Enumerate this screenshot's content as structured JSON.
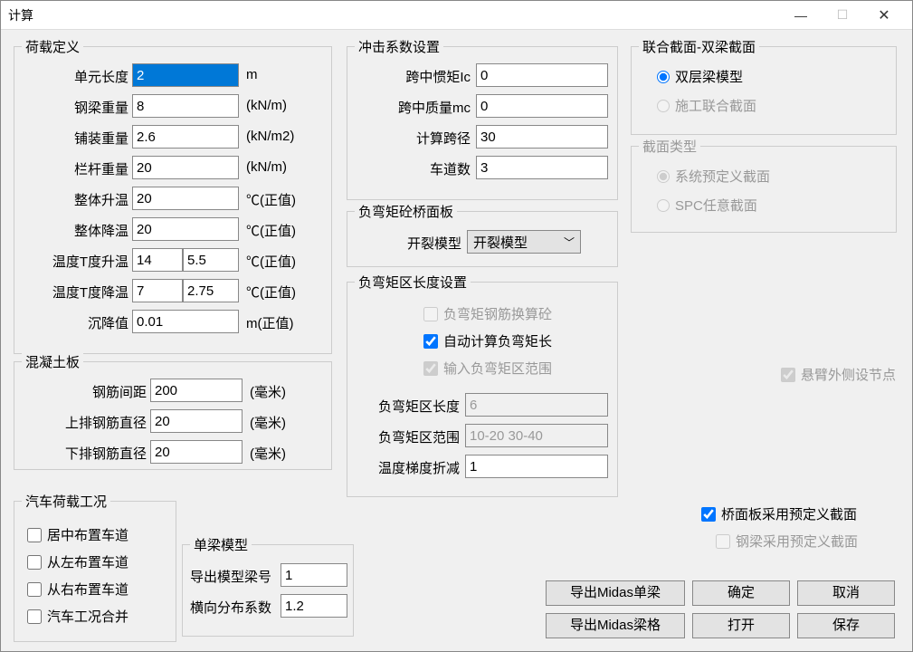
{
  "window": {
    "title": "计算"
  },
  "load": {
    "legend": "荷载定义",
    "unitLength": {
      "label": "单元长度",
      "value": "2",
      "unit": "m"
    },
    "steelBeamWeight": {
      "label": "钢梁重量",
      "value": "8",
      "unit": "(kN/m)"
    },
    "pavingWeight": {
      "label": "铺装重量",
      "value": "2.6",
      "unit": "(kN/m2)"
    },
    "railWeight": {
      "label": "栏杆重量",
      "value": "20",
      "unit": "(kN/m)"
    },
    "tempUp": {
      "label": "整体升温",
      "value": "20",
      "unit": "℃(正值)"
    },
    "tempDown": {
      "label": "整体降温",
      "value": "20",
      "unit": "℃(正值)"
    },
    "tGradUp": {
      "label": "温度T度升温",
      "v1": "14",
      "v2": "5.5",
      "unit": "℃(正值)"
    },
    "tGradDown": {
      "label": "温度T度降温",
      "v1": "7",
      "v2": "2.75",
      "unit": "℃(正值)"
    },
    "settlement": {
      "label": "沉降值",
      "value": "0.01",
      "unit": "m(正值)"
    }
  },
  "concrete": {
    "legend": "混凝土板",
    "rebarSpacing": {
      "label": "钢筋间距",
      "value": "200",
      "unit": "(毫米)"
    },
    "topRebarDia": {
      "label": "上排钢筋直径",
      "value": "20",
      "unit": "(毫米)"
    },
    "botRebarDia": {
      "label": "下排钢筋直径",
      "value": "20",
      "unit": "(毫米)"
    }
  },
  "vehicle": {
    "legend": "汽车荷载工况",
    "center": "居中布置车道",
    "left": "从左布置车道",
    "right": "从右布置车道",
    "combine": "汽车工况合并"
  },
  "singleBeam": {
    "legend": "单梁模型",
    "exportBeamNo": {
      "label": "导出模型梁号",
      "value": "1"
    },
    "lateralCoef": {
      "label": "横向分布系数",
      "value": "1.2"
    }
  },
  "impact": {
    "legend": "冲击系数设置",
    "midInertia": {
      "label": "跨中惯矩Ic",
      "value": "0"
    },
    "midMass": {
      "label": "跨中质量mc",
      "value": "0"
    },
    "span": {
      "label": "计算跨径",
      "value": "30"
    },
    "lanes": {
      "label": "车道数",
      "value": "3"
    }
  },
  "negDeck": {
    "legend": "负弯矩砼桥面板",
    "crackModelLabel": "开裂模型",
    "crackModelValue": "开裂模型"
  },
  "negZone": {
    "legend": "负弯矩区长度设置",
    "cbConvert": "负弯矩钢筋换算砼",
    "cbAuto": "自动计算负弯矩长",
    "cbRange": "输入负弯矩区范围",
    "negLength": {
      "label": "负弯矩区长度",
      "value": "6"
    },
    "negRange": {
      "label": "负弯矩区范围",
      "value": "10-20 30-40"
    },
    "tempGradRed": {
      "label": "温度梯度折减",
      "value": "1"
    }
  },
  "composite": {
    "legend": "联合截面-双梁截面",
    "doubleLayer": "双层梁模型",
    "construction": "施工联合截面"
  },
  "sectionType": {
    "legend": "截面类型",
    "system": "系统预定义截面",
    "spc": "SPC任意截面"
  },
  "cantilever": "悬臂外侧设节点",
  "deckPredef": "桥面板采用预定义截面",
  "steelPredef": "钢梁采用预定义截面",
  "buttons": {
    "exportMidasSingle": "导出Midas单梁",
    "exportMidasGrid": "导出Midas梁格",
    "ok": "确定",
    "open": "打开",
    "cancel": "取消",
    "save": "保存"
  }
}
